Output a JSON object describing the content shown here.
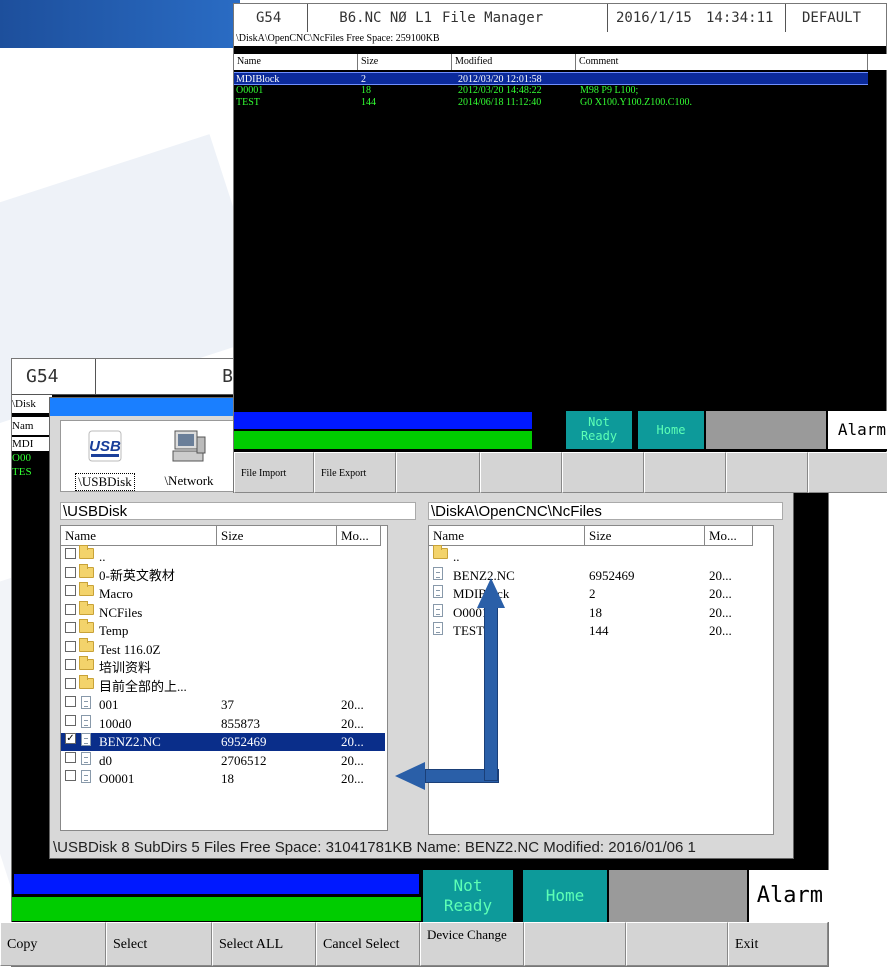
{
  "back_window": {
    "header": {
      "coord": "G54",
      "program_partial": "B"
    },
    "path_partial": "\\Disk",
    "col_name_partial": "Nam",
    "rows_partial": [
      "MDI",
      "O00",
      "TES"
    ]
  },
  "dialog": {
    "drives": [
      {
        "label": "\\USBDisk",
        "icon": "usb-icon",
        "selected": true
      },
      {
        "label": "\\Network",
        "icon": "network-computer-icon",
        "selected": false
      }
    ],
    "left_pane": {
      "path": "\\USBDisk",
      "columns": [
        "Name",
        "Size",
        "Mo..."
      ],
      "rows": [
        {
          "type": "folder",
          "name": "..",
          "size": "",
          "mod": "",
          "checked": false
        },
        {
          "type": "folder",
          "name": "0-新英文教材",
          "size": "",
          "mod": "",
          "checked": false
        },
        {
          "type": "folder",
          "name": "Macro",
          "size": "",
          "mod": "",
          "checked": false
        },
        {
          "type": "folder",
          "name": "NCFiles",
          "size": "",
          "mod": "",
          "checked": false
        },
        {
          "type": "folder",
          "name": "Temp",
          "size": "",
          "mod": "",
          "checked": false
        },
        {
          "type": "folder",
          "name": "Test 116.0Z",
          "size": "",
          "mod": "",
          "checked": false
        },
        {
          "type": "folder",
          "name": "培训资料",
          "size": "",
          "mod": "",
          "checked": false
        },
        {
          "type": "folder",
          "name": "目前全部的上...",
          "size": "",
          "mod": "",
          "checked": false
        },
        {
          "type": "file",
          "name": "001",
          "size": "37",
          "mod": "20...",
          "checked": false
        },
        {
          "type": "file",
          "name": "100d0",
          "size": "855873",
          "mod": "20...",
          "checked": false
        },
        {
          "type": "file",
          "name": "BENZ2.NC",
          "size": "6952469",
          "mod": "20...",
          "checked": true,
          "selected": true
        },
        {
          "type": "file",
          "name": "d0",
          "size": "2706512",
          "mod": "20...",
          "checked": false
        },
        {
          "type": "file",
          "name": "O0001",
          "size": "18",
          "mod": "20...",
          "checked": false
        }
      ]
    },
    "right_pane": {
      "path": "\\DiskA\\OpenCNC\\NcFiles",
      "columns": [
        "Name",
        "Size",
        "Mo..."
      ],
      "rows": [
        {
          "type": "folder",
          "name": "..",
          "size": "",
          "mod": ""
        },
        {
          "type": "file",
          "name": "BENZ2.NC",
          "size": "6952469",
          "mod": "20..."
        },
        {
          "type": "file",
          "name": "MDIBlock",
          "size": "2",
          "mod": "20..."
        },
        {
          "type": "file",
          "name": "O0001",
          "size": "18",
          "mod": "20..."
        },
        {
          "type": "file",
          "name": "TEST",
          "size": "144",
          "mod": "20..."
        }
      ]
    },
    "status": "\\USBDisk 8 SubDirs 5 Files Free Space: 31041781KB    Name: BENZ2.NC Modified: 2016/01/06 1"
  },
  "back_status": {
    "ready_line1": "Not",
    "ready_line2": "Ready",
    "mode": "Home",
    "alarm": "Alarm"
  },
  "back_fkeys": [
    "Copy",
    "Select",
    "Select ALL",
    "Cancel Select",
    "Device Change",
    "",
    "",
    "Exit"
  ],
  "front_window": {
    "header": {
      "coord": "G54",
      "program": "B6.NC NØ L1",
      "title": "File Manager",
      "date": "2016/1/15",
      "time": "14:34:11",
      "profile": "DEFAULT"
    },
    "path_line": "\\DiskA\\OpenCNC\\NcFiles   Free Space: 259100KB",
    "columns": [
      "Name",
      "Size",
      "Modified",
      "Comment"
    ],
    "rows": [
      {
        "name": "MDIBlock",
        "size": "2",
        "modified": "2012/03/20 12:01:58",
        "comment": "",
        "selected": true
      },
      {
        "name": "O0001",
        "size": "18",
        "modified": "2012/03/20 14:48:22",
        "comment": "M98 P9 L100;",
        "selected": false
      },
      {
        "name": "TEST",
        "size": "144",
        "modified": "2014/06/18 11:12:40",
        "comment": "G0 X100.Y100.Z100.C100.",
        "selected": false
      }
    ],
    "status": {
      "ready_line1": "Not",
      "ready_line2": "Ready",
      "mode": "Home",
      "alarm": "Alarm"
    },
    "fkeys": [
      "File Import",
      "File Export",
      "",
      "",
      "",
      "",
      "",
      ""
    ]
  },
  "colors": {
    "accent_blue": "#0019ff",
    "ready_green": "#00cc00",
    "status_teal": "#0d9a9a",
    "text_green": "#33ff33",
    "selection_navy": "#0a2e8a",
    "arrow_blue": "#2a5fa8"
  }
}
